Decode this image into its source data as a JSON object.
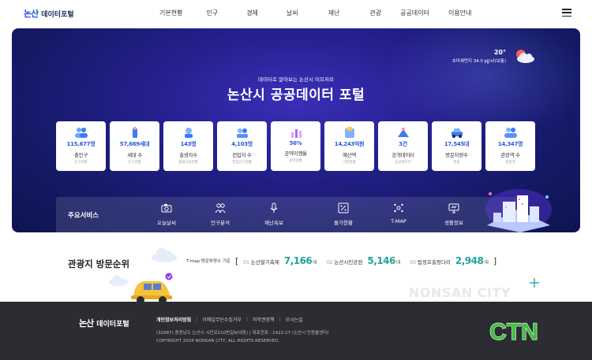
{
  "header": {
    "logo_mark": "논산",
    "logo_text": "데이터포털",
    "nav": [
      "기본현황",
      "인구",
      "경제",
      "날씨",
      "재난",
      "관광",
      "공공데이터",
      "이용안내"
    ]
  },
  "hero": {
    "weather": {
      "temp": "20°",
      "air": "초미세먼지 34.0 ㎍/㎥(보통)"
    },
    "subtitle": "데이터로 알아보는 논산시 이모저모",
    "title": "논산시 공공데이터 포털",
    "stats": [
      {
        "value": "115,677명",
        "label": "총인구",
        "source": "인구현황",
        "icon": "people-icon"
      },
      {
        "value": "57,669세대",
        "label": "세대 수",
        "source": "인구현황",
        "icon": "household-icon"
      },
      {
        "value": "143명",
        "label": "출생자수",
        "source": "출생사망현황",
        "icon": "baby-icon"
      },
      {
        "value": "4,103명",
        "label": "전입자 수",
        "source": "전입인구현황",
        "icon": "move-in-icon"
      },
      {
        "value": "56%",
        "label": "공약이행율",
        "source": "공약현황",
        "icon": "pledge-chart-icon"
      },
      {
        "value": "14,243억원",
        "label": "예산액",
        "source": "기본현황",
        "icon": "budget-icon"
      },
      {
        "value": "3건",
        "label": "공개데이터",
        "source": "공공데이터",
        "icon": "open-data-icon"
      },
      {
        "value": "17,545대",
        "label": "방문차량수",
        "source": "관광",
        "icon": "car-icon"
      },
      {
        "value": "14,347명",
        "label": "관광객 수",
        "source": "관광객",
        "icon": "tourist-icon"
      }
    ],
    "services": {
      "heading": "주요서비스",
      "items": [
        "오늘날씨",
        "인구분석",
        "재난속보",
        "물가현황",
        "T-MAP",
        "생활정보"
      ]
    }
  },
  "ranking": {
    "title": "관광지 방문순위",
    "note": "T-map 방문차량수 기준",
    "open_bracket": "[",
    "close_bracket": "]",
    "items": [
      {
        "no": "01",
        "name": "논산딸기축제",
        "count": "7,166",
        "unit": "대"
      },
      {
        "no": "02",
        "name": "논산시민공원",
        "count": "5,146",
        "unit": "대"
      },
      {
        "no": "03",
        "name": "탑정호출렁다리",
        "count": "2,948",
        "unit": "대"
      }
    ],
    "watermark": "NONSAN CITY"
  },
  "footer": {
    "logo_mark": "논산",
    "logo_text": "데이터포털",
    "links": [
      "개인정보처리방침",
      "이메일무단수집거부",
      "저작권정책",
      "오시는길"
    ],
    "address": "(32987) 충청남도 논산시 시민로210번길9(내동)   |   대표전화 : 1422-17 (논산시 민원콜센터)",
    "copyright": "COPYRIGHT 2024 NONSAN CITY, ALL RIGHTS RESERVED.",
    "brand": "CTN"
  },
  "colors": {
    "accent": "#2a5bd7",
    "teal": "#1fa39a",
    "hero_dark": "#141a66",
    "footer": "#2b2d33",
    "ctn_green": "#3cc23c"
  }
}
